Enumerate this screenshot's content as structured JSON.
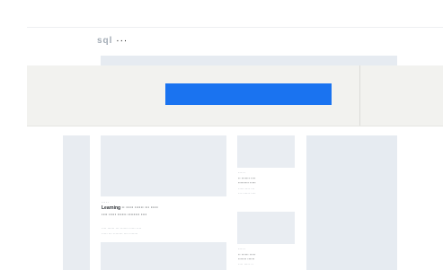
{
  "header": {
    "logo_main": "sql",
    "logo_rest": "···"
  },
  "banner": {
    "cta_label": ""
  },
  "feed": {
    "main_article": {
      "meta": "··· ··",
      "title_line1": "Learning ·· ····· ······ ··· ·····",
      "title_line2": "···· ····· ······ ········ ····",
      "snippet_line1": "···· ······ ··· ······· ····· ····",
      "snippet_line2": "····· ··· ········ ···· ·······"
    },
    "side_articles": [
      {
        "meta": "··· ··",
        "title_line1": "·· ······· ····",
        "title_line2": "········· ·····",
        "snippet_line1": "····· ···· ···",
        "snippet_line2": "··· ······ ····"
      },
      {
        "meta": "··· ··",
        "title_line1": "·· ······ ·····",
        "title_line2": "······· ······",
        "snippet_line1": "···· ····· ··"
      }
    ]
  },
  "colors": {
    "accent": "#1a73f0",
    "placeholder": "#e9edf2",
    "banner_bg": "#f2f2ef"
  }
}
